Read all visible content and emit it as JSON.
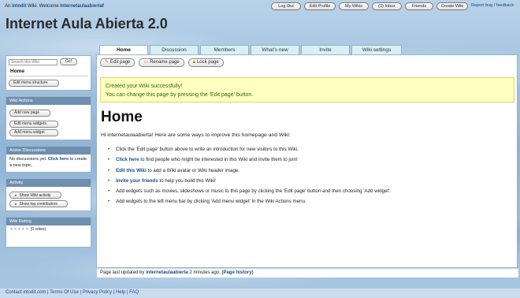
{
  "topbar": {
    "welcome_prefix": "An",
    "brand": "intodit",
    "welcome_mid": "Wiki.   Welcome",
    "username": "Internetaulaabiertaf",
    "buttons": [
      "Log Out",
      "Edit Profile",
      "My Wikis",
      "(0) Inbox",
      "Friends",
      "Create Wiki"
    ],
    "links": "Report bug / feedback"
  },
  "wiki_title": "Internet Aula Abierta 2.0",
  "tabs": [
    "Home",
    "Discussion",
    "Members",
    "What's new",
    "Invite",
    "Wiki settings"
  ],
  "sidebar": {
    "search_placeholder": "Search this Wiki",
    "search_button": "Go!",
    "home_label": "Home",
    "edit_menu_structure": "Edit menu structure",
    "wiki_actions": {
      "title": "Wiki Actions",
      "buttons": [
        "Add new page",
        "Edit menu widgets",
        "Add menu widget"
      ]
    },
    "active_discussions": {
      "title": "Active Discussions",
      "text_before": "No discussions yet.",
      "link": "Click here",
      "text_after": "to create a new topic."
    },
    "activity": {
      "title": "Activity",
      "buttons": [
        "Show Wiki activity",
        "Show top contributors"
      ]
    },
    "rating": {
      "title": "Wiki Rating",
      "votes": "(0 votes)"
    }
  },
  "toolbar": [
    "Edit page",
    "Rename page",
    "Lock page"
  ],
  "notice": {
    "line1": "Created your Wiki successfully!",
    "line2": "You can change this page by pressing the 'Edit page' button."
  },
  "page": {
    "title": "Home",
    "intro": "Hi internetaulaabierta! Here are some ways to improve this homepage and Wiki:",
    "bullets": [
      {
        "bold": "",
        "text": "Click the 'Edit page' button above to write an introduction for new visitors to this Wiki."
      },
      {
        "bold": "Click here",
        "text": " to find people who might be interested in this Wiki and invite them to join!"
      },
      {
        "bold": "Edit this Wiki",
        "text": " to add a Wiki avatar or Wiki header image."
      },
      {
        "bold": "Invite your friends",
        "text": " to help you build this Wiki!"
      },
      {
        "bold": "",
        "text": "Add widgets such as movies, slideshows or music to this page by clicking the 'Edit page' button and then choosing 'Add widget'."
      },
      {
        "bold": "",
        "text": "Add widgets to the left menu bar by clicking 'Add menu widget' in the Wiki Actions menu."
      }
    ],
    "last_updated_prefix": "Page last updated by",
    "last_updated_user": "internetaulaabierta",
    "last_updated_suffix": "2 minutes ago.",
    "page_history": "(Page history)"
  },
  "footer": "Contact intodit.com | Terms Of Use | Privacy Policy | Help | FAQ"
}
